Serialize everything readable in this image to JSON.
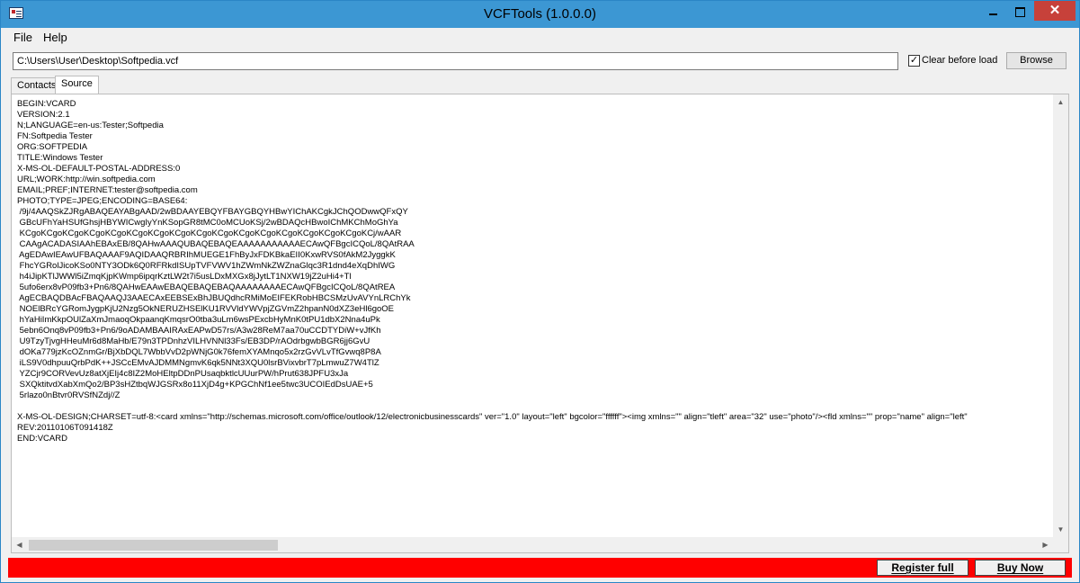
{
  "window": {
    "title": "VCFTools (1.0.0.0)",
    "controls": {
      "minimize": "",
      "maximize": "",
      "close": "✕"
    }
  },
  "menu": [
    "File",
    "Help"
  ],
  "toolbar": {
    "path": "C:\\Users\\User\\Desktop\\Softpedia.vcf",
    "clear_label": "Clear before load",
    "clear_checked": true,
    "browse_label": "Browse"
  },
  "tabs": [
    "Contacts",
    "Source"
  ],
  "active_tab": "Source",
  "source_lines": [
    "BEGIN:VCARD",
    "VERSION:2.1",
    "N;LANGUAGE=en-us:Tester;Softpedia",
    "FN:Softpedia Tester",
    "ORG:SOFTPEDIA",
    "TITLE:Windows Tester",
    "X-MS-OL-DEFAULT-POSTAL-ADDRESS:0",
    "URL;WORK:http://win.softpedia.com",
    "EMAIL;PREF;INTERNET:tester@softpedia.com",
    "PHOTO;TYPE=JPEG;ENCODING=BASE64:",
    " /9j/4AAQSkZJRgABAQEAYABgAAD/2wBDAAYEBQYFBAYGBQYHBwYIChAKCgkJChQODwwQFxQY",
    " GBcUFhYaHSUfGhsjHBYWICwgIyYnKSopGR8tMC0oMCUoKSj/2wBDAQcHBwoIChMKChMoGhYa",
    " KCgoKCgoKCgoKCgoKCgoKCgoKCgoKCgoKCgoKCgoKCgoKCgoKCgoKCgoKCgoKCgoKCj/wAAR",
    " CAAgACADASIAAhEBAxEB/8QAHwAAAQUBAQEBAQEAAAAAAAAAAAECAwQFBgcICQoL/8QAtRAA",
    " AgEDAwIEAwUFBAQAAAF9AQIDAAQRBRIhMUEGE1FhByJxFDKBkaEII0KxwRVS0fAkM2JyggkK",
    " FhcYGRolJicoKSo0NTY3ODk6Q0RFRkdISUpTVFVWV1hZWmNkZWZnaGlqc3R1dnd4eXqDhIWG",
    " h4iJipKTlJWWl5iZmqKjpKWmp6ipqrKztLW2t7i5usLDxMXGx8jJytLT1NXW19jZ2uHi4+Tl",
    " 5ufo6erx8vP09fb3+Pn6/8QAHwEAAwEBAQEBAQEBAQAAAAAAAAECAwQFBgcICQoL/8QAtREA",
    " AgECBAQDBAcFBAQAAQJ3AAECAxEEBSExBhJBUQdhcRMiMoEIFEKRobHBCSMzUvAVYnLRChYk",
    " NOElBRcYGRomJygpKjU2Nzg5OkNERUZHSElKU1RVVldYWVpjZGVmZ2hpanN0dXZ3eHl6goOE",
    " hYaHiImKkpOUlZaXmJmaoqOkpaanqKmqsrO0tba3uLm6wsPExcbHyMnK0tPU1dbX2Nna4uPk",
    " 5ebn6Onq8vP09fb3+Pn6/9oADAMBAAIRAxEAPwD57rs/A3w28ReM7aa70uCCDTYDiW+vJfKh",
    " U9TzyTjvgHHeuMr6d8MaHb/E79n3TPDnhzVILHVNNl33Fs/EB3DP/rAOdrbgwbBGR6jj6GvU",
    " dOKa779jzKcOZnmGr/BjXbDQL7WbbVvD2pWNjG0k76femXYAMnqo5x2rzGvVLvTfGvwq8P8A",
    " iLS9V0dhpuuQrbPdK++JSCcEMvAJDMMNgmvK6qk5NNt3XQU0lsrBVixvbrT7pLmwuZ7W4TlZ",
    " YZCjr9CORVevUz8atXjEIj4c8IZ2MoHEltpDDnPUsaqbktlcUUurPW/hPrut638JPFU3xJa",
    " SXQktitvdXabXmQo2/BP3sHZtbqWJGSRx8o11XjD4g+KPGChNf1ee5twc3UCOIEdDsUAE+5",
    " 5rlazo0nBtvr0RVSfNZdj//Z",
    "",
    "X-MS-OL-DESIGN;CHARSET=utf-8:<card xmlns=\"http://schemas.microsoft.com/office/outlook/12/electronicbusinesscards\" ver=\"1.0\" layout=\"left\" bgcolor=\"ffffff\"><img xmlns=\"\" align=\"tleft\" area=\"32\" use=\"photo\"/><fld xmlns=\"\" prop=\"name\" align=\"left\"",
    "REV:20110106T091418Z",
    "END:VCARD"
  ],
  "bottom_bar": {
    "color": "#ff0000",
    "register_label": "Register full",
    "buy_label": "Buy Now"
  },
  "icons": {
    "app": "vcard-app-icon",
    "scroll_up": "▲",
    "scroll_down": "▼",
    "scroll_left": "◀",
    "scroll_right": "▶"
  }
}
